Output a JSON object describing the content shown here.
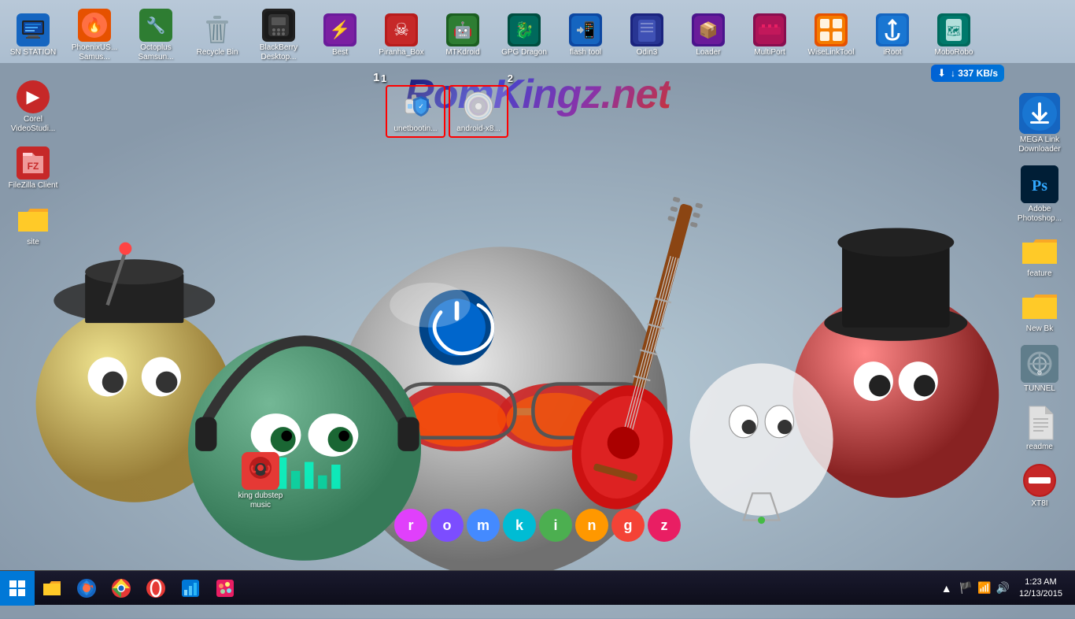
{
  "desktop": {
    "background_colors": [
      "#b8c8d8",
      "#8899aa",
      "#c8c8b4"
    ],
    "logo": "RomKingz.net",
    "romkingz_letters": [
      "r",
      "o",
      "m",
      "k",
      "i",
      "n",
      "g",
      "z"
    ],
    "letter_colors": [
      "#e040fb",
      "#7c4dff",
      "#448aff",
      "#00bcd4",
      "#4caf50",
      "#ff9800",
      "#f44336",
      "#e91e63"
    ]
  },
  "top_icons": [
    {
      "label": "SN STATION",
      "color": "#1565c0",
      "emoji": "🖥️"
    },
    {
      "label": "PhoenixUS... Samus...",
      "color": "#e65100",
      "emoji": "🔥"
    },
    {
      "label": "Octoplus Samsun...",
      "color": "#2e7d32",
      "emoji": "🔧"
    },
    {
      "label": "Recycle Bin",
      "color": "#546e7a",
      "emoji": "🗑️"
    },
    {
      "label": "BlackBerry Desktop...",
      "color": "#212121",
      "emoji": "📱"
    },
    {
      "label": "Best",
      "color": "#6a1b9a",
      "emoji": "⚡"
    },
    {
      "label": "Piranha_Box",
      "color": "#b71c1c",
      "emoji": "☠️"
    },
    {
      "label": "MTKdroid",
      "color": "#1b5e20",
      "emoji": "🤖"
    },
    {
      "label": "GPG Dragon",
      "color": "#004d40",
      "emoji": "🐉"
    },
    {
      "label": "flash tool",
      "color": "#0d47a1",
      "emoji": "📲"
    },
    {
      "label": "Odin3",
      "color": "#1a237e",
      "emoji": "📱"
    },
    {
      "label": "Loader",
      "color": "#4a148c",
      "emoji": "📦"
    },
    {
      "label": "MultiPort",
      "color": "#880e4f",
      "emoji": "🔌"
    },
    {
      "label": "WiseLinkTool",
      "color": "#e65100",
      "emoji": "🔗"
    },
    {
      "label": "iRoot",
      "color": "#1565c0",
      "emoji": "⚓"
    },
    {
      "label": "MoboRobo",
      "color": "#00695c",
      "emoji": "🗺️"
    }
  ],
  "floating_icons": [
    {
      "label": "unetbootin...",
      "color": "#d32f2f",
      "emoji": "💾",
      "number": "1"
    },
    {
      "label": "android-x8...",
      "color": "#546e7a",
      "emoji": "💿",
      "number": "2"
    }
  ],
  "left_icons": [
    {
      "label": "Corel VideoStudi...",
      "color": "#c62828",
      "emoji": "🎬"
    },
    {
      "label": "FileZilla Client",
      "color": "#c62828",
      "emoji": "📁"
    },
    {
      "label": "site",
      "color": "#f9a825",
      "emoji": "📂"
    }
  ],
  "right_icons": [
    {
      "label": "MEGA Link Downloader",
      "color": "#0d47a1",
      "emoji": "⬇️",
      "is_mega": true
    },
    {
      "label": "Adobe Photoshop...",
      "color": "#0d47a1",
      "emoji": "🎨"
    },
    {
      "label": "feature",
      "color": "#f9a825",
      "emoji": "📂"
    },
    {
      "label": "New Bk",
      "color": "#f9a825",
      "emoji": "📂"
    },
    {
      "label": "TUNNEL",
      "color": "#546e7a",
      "emoji": "⚙️"
    },
    {
      "label": "readme",
      "color": "#e0e0e0",
      "emoji": "📄"
    },
    {
      "label": "XT8I",
      "color": "#b71c1c",
      "emoji": "🚫"
    }
  ],
  "mega_speed": "↓ 337 KB/s",
  "center_icon": {
    "label": "king dubstep music",
    "color": "#e53935",
    "emoji": "🎧"
  },
  "taskbar": {
    "pinned": [
      {
        "name": "file-explorer",
        "emoji": "📁",
        "color": "#f9a825"
      },
      {
        "name": "firefox",
        "emoji": "🦊",
        "color": "#e65100"
      },
      {
        "name": "chrome",
        "emoji": "🌐",
        "color": "#4caf50"
      },
      {
        "name": "opera",
        "emoji": "🔴",
        "color": "#e53935"
      },
      {
        "name": "task-manager",
        "emoji": "📊",
        "color": "#0078d7"
      },
      {
        "name": "paint",
        "emoji": "🎨",
        "color": "#e91e63"
      }
    ],
    "clock_time": "1:23 AM",
    "clock_date": "12/13/2015"
  }
}
